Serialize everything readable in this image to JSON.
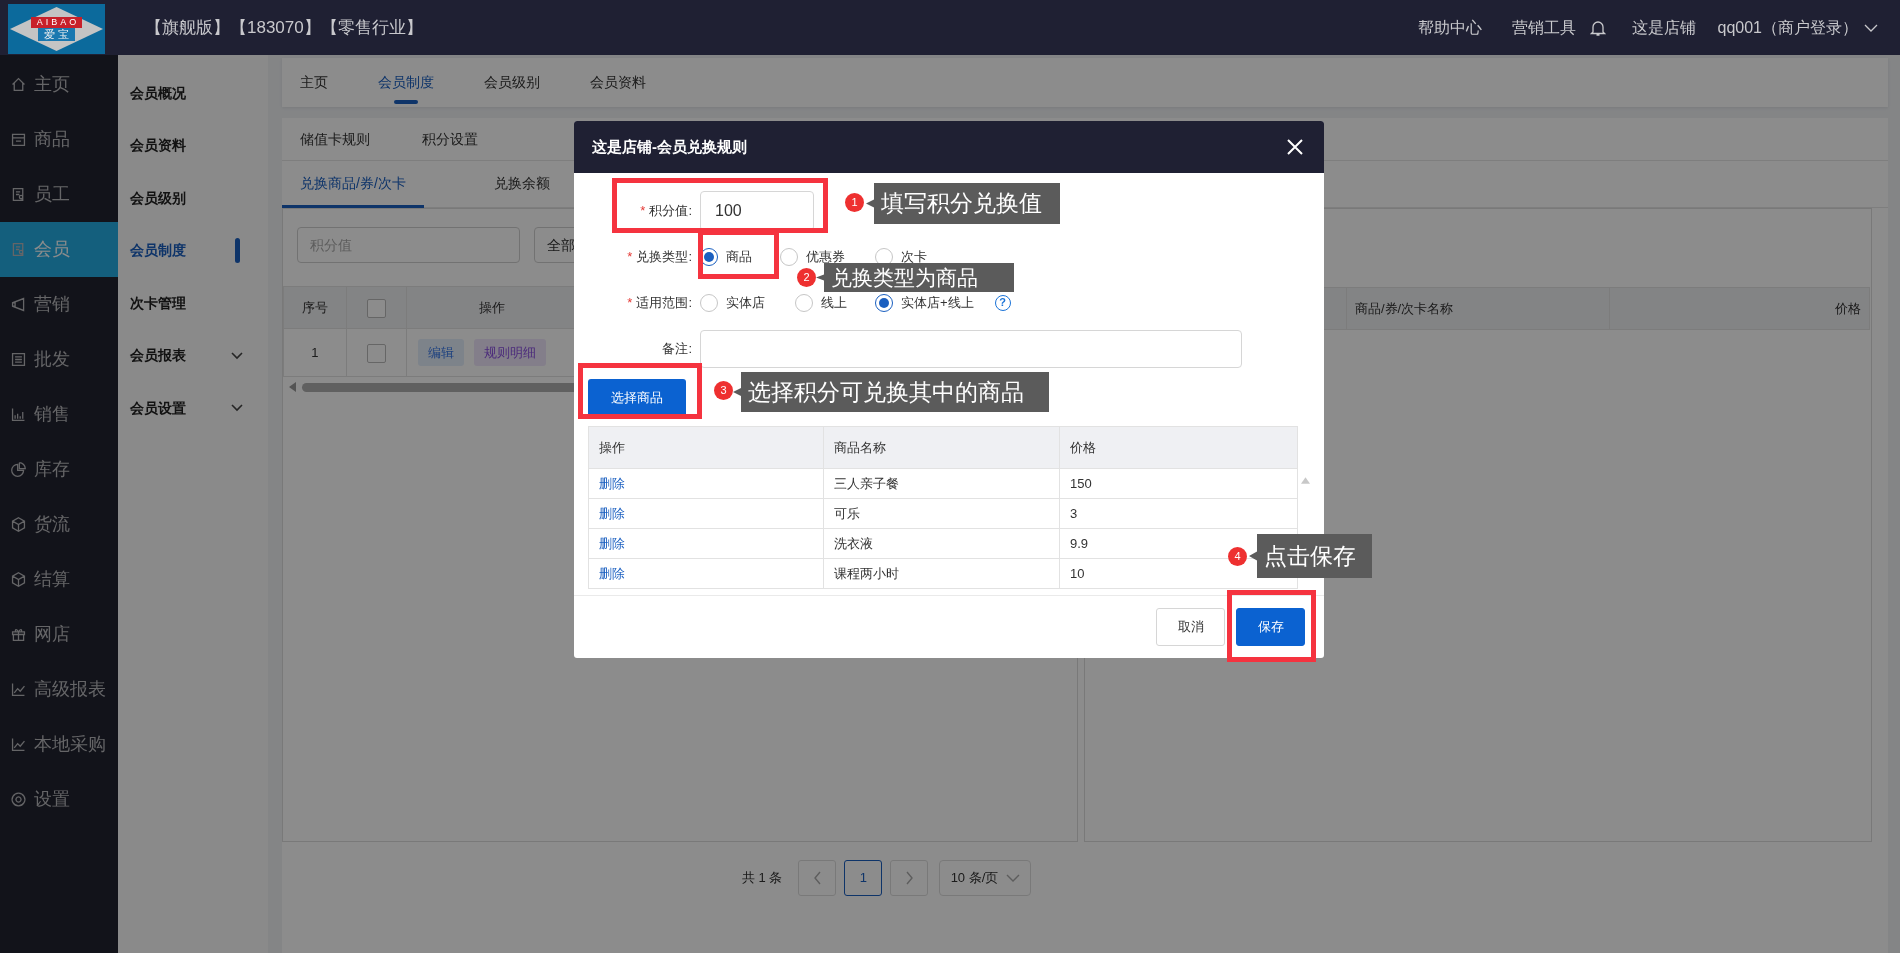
{
  "header": {
    "logo": {
      "top": "AIBAO",
      "bottom": "爱 宝"
    },
    "edition": "【旗舰版】【183070】【零售行业】",
    "links": [
      {
        "label": "帮助中心"
      },
      {
        "label": "营销工具"
      }
    ],
    "store": "这是店铺",
    "user": "qq001（商户登录）"
  },
  "sidebar": {
    "items": [
      {
        "label": "主页",
        "selected": false
      },
      {
        "label": "商品",
        "selected": false
      },
      {
        "label": "员工",
        "selected": false
      },
      {
        "label": "会员",
        "selected": true
      },
      {
        "label": "营销",
        "selected": false
      },
      {
        "label": "批发",
        "selected": false
      },
      {
        "label": "销售",
        "selected": false
      },
      {
        "label": "库存",
        "selected": false
      },
      {
        "label": "货流",
        "selected": false
      },
      {
        "label": "结算",
        "selected": false
      },
      {
        "label": "网店",
        "selected": false
      },
      {
        "label": "高级报表",
        "selected": false
      },
      {
        "label": "本地采购",
        "selected": false
      },
      {
        "label": "设置",
        "selected": false
      }
    ]
  },
  "subnav": {
    "items": [
      {
        "label": "会员概况",
        "kind": "link",
        "selected": false
      },
      {
        "label": "会员资料",
        "kind": "link",
        "selected": false
      },
      {
        "label": "会员级别",
        "kind": "link",
        "selected": false
      },
      {
        "label": "会员制度",
        "kind": "link",
        "selected": true
      },
      {
        "label": "次卡管理",
        "kind": "link",
        "selected": false
      },
      {
        "label": "会员报表",
        "kind": "group",
        "selected": false
      },
      {
        "label": "会员设置",
        "kind": "group",
        "selected": false
      }
    ]
  },
  "tabs": [
    {
      "label": "主页",
      "selected": false
    },
    {
      "label": "会员制度",
      "selected": true
    },
    {
      "label": "会员级别",
      "selected": false
    },
    {
      "label": "会员资料",
      "selected": false
    }
  ],
  "sub_tabs": [
    {
      "items": [
        {
          "label": "储值卡规则",
          "selected": false
        },
        {
          "label": "积分设置",
          "selected": false
        }
      ]
    },
    {
      "items": [
        {
          "label": "兑换商品/券/次卡",
          "selected": true
        },
        {
          "label": "兑换余额",
          "selected": false
        }
      ]
    }
  ],
  "rules_panel": {
    "search_placeholder": "积分值",
    "scope": "全部",
    "table": {
      "columns": [
        "序号",
        "操作"
      ],
      "header_checked": false,
      "rows": [
        {
          "no": "1",
          "checked": false,
          "actions": [
            {
              "label": "编辑",
              "kind": "edit"
            },
            {
              "label": "规则明细",
              "kind": "detail"
            }
          ]
        }
      ]
    }
  },
  "items_panel": {
    "columns": [
      "商品/券/次卡名称",
      "价格"
    ]
  },
  "pagination": {
    "total": "共 1 条",
    "pages": [
      {
        "label": "1",
        "selected": true
      }
    ],
    "page_size": "10 条/页"
  },
  "dialog": {
    "title": "这是店铺-会员兑换规则",
    "fields": [
      {
        "kind": "input",
        "marker": "*",
        "label": "积分值:",
        "value": "100"
      },
      {
        "kind": "radio",
        "marker": "*",
        "label": "兑换类型:",
        "options": [
          {
            "label": "商品",
            "selected": true
          },
          {
            "label": "优惠券",
            "selected": false
          },
          {
            "label": "次卡",
            "selected": false
          }
        ]
      },
      {
        "kind": "radio",
        "marker": "*",
        "label": "适用范围:",
        "help": "?",
        "options": [
          {
            "label": "实体店",
            "selected": false
          },
          {
            "label": "线上",
            "selected": false
          },
          {
            "label": "实体店+线上",
            "selected": true
          }
        ]
      },
      {
        "kind": "input",
        "label": "备注:"
      }
    ],
    "select_button": "选择商品",
    "table": {
      "columns": [
        "操作",
        "商品名称",
        "价格"
      ],
      "rows": [
        {
          "action": "删除",
          "name": "三人亲子餐",
          "price": "150"
        },
        {
          "action": "删除",
          "name": "可乐",
          "price": "3"
        },
        {
          "action": "删除",
          "name": "洗衣液",
          "price": "9.9"
        },
        {
          "action": "删除",
          "name": "课程两小时",
          "price": "10"
        }
      ]
    },
    "buttons": [
      {
        "label": "取消",
        "kind": "default"
      },
      {
        "label": "保存",
        "kind": "primary"
      }
    ]
  },
  "annotations": [
    {
      "number": "1",
      "text": "填写积分兑换值"
    },
    {
      "number": "2",
      "text": "兑换类型为商品"
    },
    {
      "number": "3",
      "text": "选择积分可兑换其中的商品"
    },
    {
      "number": "4",
      "text": "点击保存"
    }
  ]
}
